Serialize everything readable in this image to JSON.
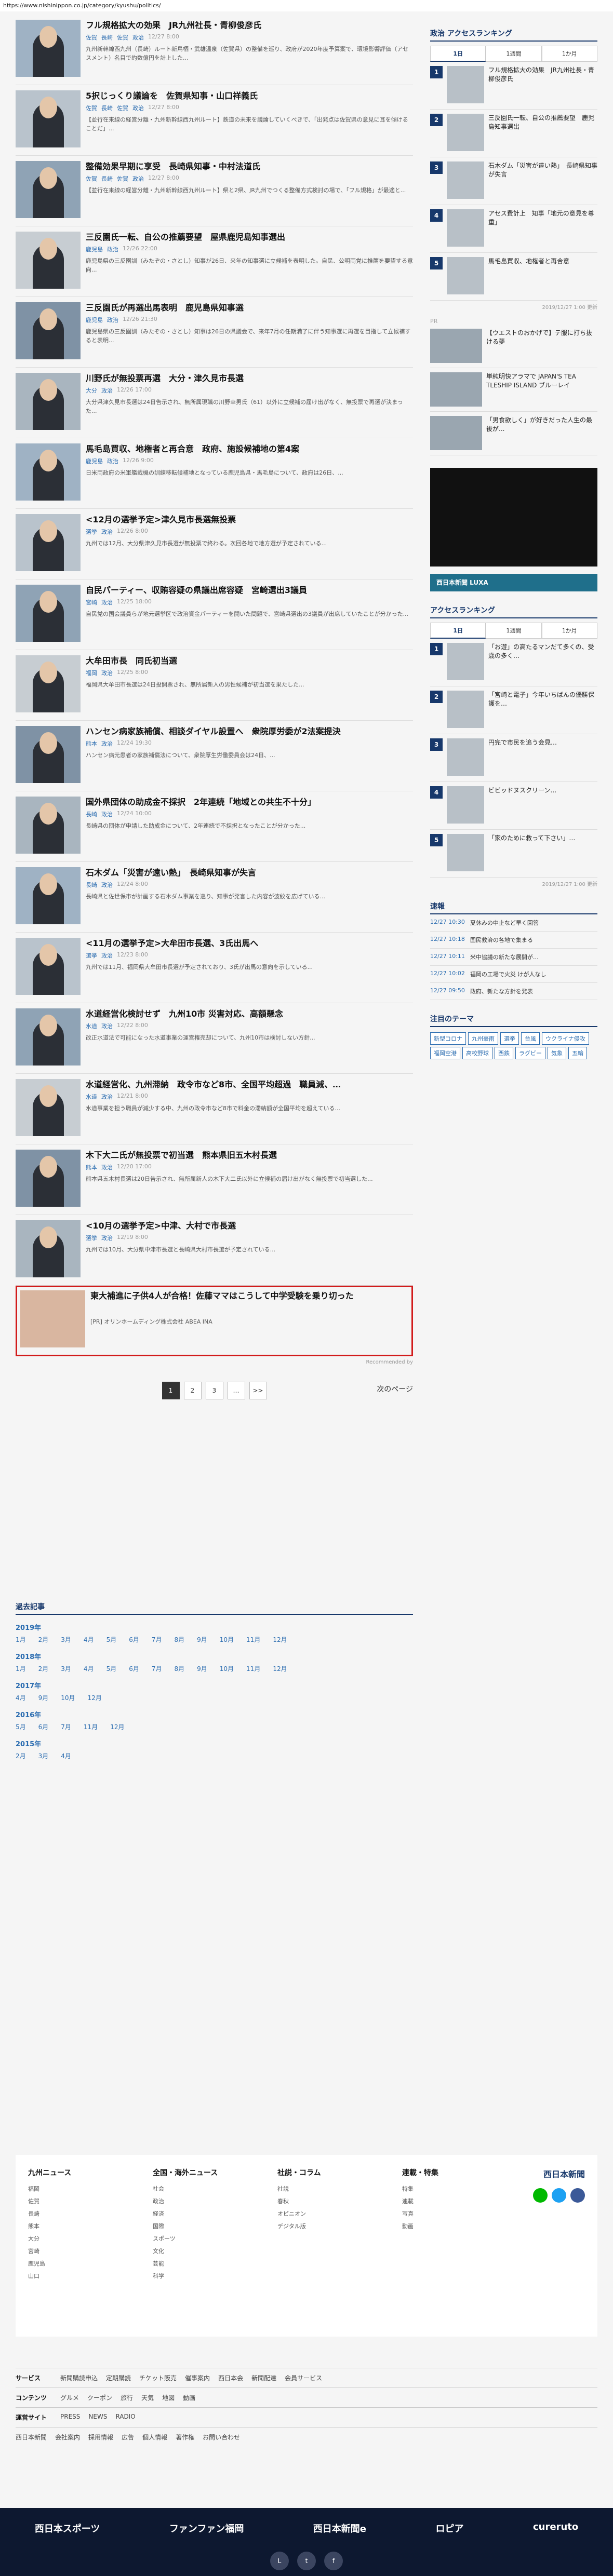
{
  "url": "https://www.nishinippon.co.jp/category/kyushu/politics/",
  "articles": [
    {
      "title": "フル規格拡大の効果　JR九州社長・青柳俊彦氏",
      "tags": [
        "佐賀",
        "長崎",
        "佐賀",
        "政治"
      ],
      "date": "12/27 8:00",
      "lead": "九州新幹線西九州（長崎）ルート新鳥栖・武雄温泉（佐賀県）の整備を巡り、政府が2020年度予算案で、環境影響評価（アセスメント）名目で約数億円を計上した..."
    },
    {
      "title": "5択じっくり議論を　佐賀県知事・山口祥義氏",
      "tags": [
        "佐賀",
        "長崎",
        "佐賀",
        "政治"
      ],
      "date": "12/27 8:00",
      "lead": "【並行在来線の経営分離・九州新幹線西九州ルート】鉄道の未来を議論していくべきで、「出発点は佐賀県の意見に耳を傾けることだ」..."
    },
    {
      "title": "整備効果早期に享受　長崎県知事・中村法道氏",
      "tags": [
        "佐賀",
        "長崎",
        "佐賀",
        "政治"
      ],
      "date": "12/27 8:00",
      "lead": "【並行在来線の経営分離・九州新幹線西九州ルート】県と2県、JR九州でつくる整備方式検討の場で、「フル規格」が最適と..."
    },
    {
      "title": "三反園氏一転、自公の推薦要望　屋県鹿児島知事選出",
      "tags": [
        "鹿児島",
        "政治"
      ],
      "date": "12/26 22:00",
      "lead": "鹿児島県の三反園訓（みたぞの・さとし）知事が26日、来年の知事選に立候補を表明した。自民、公明両党に推薦を要望する意向..."
    },
    {
      "title": "三反園氏が再選出馬表明　鹿児島県知事選",
      "tags": [
        "鹿児島",
        "政治"
      ],
      "date": "12/26 21:30",
      "lead": "鹿児島県の三反園訓（みたぞの・さとし）知事は26日の県議会で、来年7月の任期満了に伴う知事選に再選を目指して立候補すると表明..."
    },
    {
      "title": "川野氏が無投票再選　大分・津久見市長選",
      "tags": [
        "大分",
        "政治"
      ],
      "date": "12/26 17:00",
      "lead": "大分県津久見市長選は24日告示され、無所属現職の川野幸男氏（61）以外に立候補の届け出がなく、無投票で再選が決まった..."
    },
    {
      "title": "馬毛島買収、地権者と再合意　政府、施設候補地の第4案",
      "tags": [
        "鹿児島",
        "政治"
      ],
      "date": "12/26 9:00",
      "lead": "日米両政府の米軍艦載機の訓練移転候補地となっている鹿児島県・馬毛島について、政府は26日、..."
    },
    {
      "title": "<12月の選挙予定>津久見市長選無投票",
      "tags": [
        "選挙",
        "政治"
      ],
      "date": "12/26 8:00",
      "lead": "九州では12月、大分県津久見市長選が無投票で終わる。次回各地で地方選が予定されている..."
    },
    {
      "title": "自民パーティー、収賄容疑の県議出席容疑　宮崎選出3議員",
      "tags": [
        "宮崎",
        "政治"
      ],
      "date": "12/25 18:00",
      "lead": "自民党の国会議員らが地元選挙区で政治資金パーティーを開いた問題で、宮崎県選出の3議員が出席していたことが分かった..."
    },
    {
      "title": "大牟田市長　同氏初当選",
      "tags": [
        "福岡",
        "政治"
      ],
      "date": "12/25 8:00",
      "lead": "福岡県大牟田市長選は24日投開票され、無所属新人の男性候補が初当選を果たした..."
    },
    {
      "title": "ハンセン病家族補償、相談ダイヤル設置へ　衆院厚労委が2法案提決",
      "tags": [
        "熊本",
        "政治"
      ],
      "date": "12/24 19:30",
      "lead": "ハンセン病元患者の家族補償法について、衆院厚生労働委員会は24日、..."
    },
    {
      "title": "国外県団体の助成金不採択　2年連続「地域との共生不十分」",
      "tags": [
        "長崎",
        "政治"
      ],
      "date": "12/24 10:00",
      "lead": "長崎県の団体が申請した助成金について、2年連続で不採択となったことが分かった..."
    },
    {
      "title": "石木ダム「災害が遠い熱」　長崎県知事が失言",
      "tags": [
        "長崎",
        "政治"
      ],
      "date": "12/24 8:00",
      "lead": "長崎県と佐世保市が計画する石木ダム事業を巡り、知事が発言した内容が波紋を広げている..."
    },
    {
      "title": "<11月の選挙予定>大牟田市長選、3氏出馬へ",
      "tags": [
        "選挙",
        "政治"
      ],
      "date": "12/23 8:00",
      "lead": "九州では11月、福岡県大牟田市長選が予定されており、3氏が出馬の意向を示している..."
    },
    {
      "title": "水道経営化検討せず　九州10市 災害対応、高額懸念",
      "tags": [
        "水道",
        "政治"
      ],
      "date": "12/22 8:00",
      "lead": "改正水道法で可能になった水道事業の運営権売却について、九州10市は検討しない方針..."
    },
    {
      "title": "水道経営化、九州滞納　政令市など8市、全国平均超過　職員減、…",
      "tags": [
        "水道",
        "政治"
      ],
      "date": "12/21 8:00",
      "lead": "水道事業を担う職員が減少する中、九州の政令市など8市で料金の滞納額が全国平均を超えている..."
    },
    {
      "title": "木下大二氏が無投票で初当選　熊本県旧五木村長選",
      "tags": [
        "熊本",
        "政治"
      ],
      "date": "12/20 17:00",
      "lead": "熊本県五木村長選は20日告示され、無所属新人の木下大二氏以外に立候補の届け出がなく無投票で初当選した..."
    },
    {
      "title": "<10月の選挙予定>中津、大村で市長選",
      "tags": [
        "選挙",
        "政治"
      ],
      "date": "12/19 8:00",
      "lead": "九州では10月、大分県中津市長選と長崎県大村市長選が予定されている..."
    }
  ],
  "ad": {
    "title": "東大補進に子供4人が合格！佐藤ママはこうして中学受験を乗り切った",
    "sponsor": "[PR] オリンホームディング株式会社 ABEA INA"
  },
  "recommended": "Recommended by",
  "pager": {
    "pages": [
      "1",
      "2",
      "3",
      "…",
      ">>"
    ],
    "next": "次のページ"
  },
  "side": {
    "ranking1_title": "政治 アクセスランキング",
    "tabs1": [
      "1日",
      "1週間",
      "1か月"
    ],
    "ranking1": [
      "フル規格拡大の効果　JR九州社長・青柳俊彦氏",
      "三反園氏一転、自公の推薦要望　鹿児島知事選出",
      "石木ダム「災害が遠い熱」　長崎県知事が失言",
      "アセス費計上　知事「地元の意見を尊重」",
      "馬毛島買収、地権者と再合意"
    ],
    "ranking1_date": "2019/12/27 1:00 更新",
    "pr_label": "PR",
    "promos": [
      "【ウエストのおかげで】テ服に打ち抜ける夢",
      "単純明快アラマで JAPAN'S TEA TLESHIP ISLAND ブルーレイ",
      "「男食欲しく」が好きだった人生の最後が..."
    ],
    "banner_label": "西日本新聞 LUXA",
    "ranking2_title": "アクセスランキング",
    "tabs2": [
      "1日",
      "1週間",
      "1か月"
    ],
    "ranking2": [
      "「お遊」の高たるマンだて多くの、受歳の多く…",
      "「宮崎と電子」今年いちばんの優勝保護を…",
      "円完で市民を追う会見…",
      "ビビッドヌスクリーン…",
      "「家のために救って下さい」…"
    ],
    "ranking2_date": "2019/12/27 1:00 更新",
    "news_title": "速報",
    "news": [
      {
        "t": "12/27 10:30",
        "s": "夏休みの中止など早く回答"
      },
      {
        "t": "12/27 10:18",
        "s": "国民救済の各地で集まる"
      },
      {
        "t": "12/27 10:11",
        "s": "米中協議の新たな展開が…"
      },
      {
        "t": "12/27 10:02",
        "s": "福岡の工場で火災 けが人なし"
      },
      {
        "t": "12/27 09:50",
        "s": "政府、新たな方針を発表"
      }
    ],
    "theme_title": "注目のテーマ",
    "themes": [
      "新型コロナ",
      "九州豪雨",
      "選挙",
      "台風",
      "ウクライナ侵攻",
      "福岡空港",
      "高校野球",
      "西鉄",
      "ラグビー",
      "気象",
      "五輪"
    ]
  },
  "archive": {
    "title": "過去記事",
    "years": [
      {
        "y": "2019年",
        "m": [
          "1月",
          "2月",
          "3月",
          "4月",
          "5月",
          "6月",
          "7月",
          "8月",
          "9月",
          "10月",
          "11月",
          "12月"
        ]
      },
      {
        "y": "2018年",
        "m": [
          "1月",
          "2月",
          "3月",
          "4月",
          "5月",
          "6月",
          "7月",
          "8月",
          "9月",
          "10月",
          "11月",
          "12月"
        ]
      },
      {
        "y": "2017年",
        "m": [
          "4月",
          "9月",
          "10月",
          "12月"
        ]
      },
      {
        "y": "2016年",
        "m": [
          "5月",
          "6月",
          "7月",
          "11月",
          "12月"
        ]
      },
      {
        "y": "2015年",
        "m": [
          "2月",
          "3月",
          "4月"
        ]
      }
    ]
  },
  "footer": {
    "cols": [
      {
        "h": "九州ニュース",
        "items": [
          "福岡",
          "佐賀",
          "長崎",
          "熊本",
          "大分",
          "宮崎",
          "鹿児島",
          "山口"
        ]
      },
      {
        "h": "全国・海外ニュース",
        "items": [
          "社会",
          "政治",
          "経済",
          "国際",
          "スポーツ",
          "文化",
          "芸能",
          "科学"
        ]
      },
      {
        "h": "社説・コラム",
        "items": [
          "社説",
          "春秋",
          "オピニオン",
          "デジタル版"
        ]
      },
      {
        "h": "連載・特集",
        "items": [
          "特集",
          "連載",
          "写真",
          "動画"
        ]
      }
    ],
    "brand": "西日本新聞"
  },
  "bottomnav": [
    {
      "k": "サービス",
      "v": [
        "新聞購読申込",
        "定期購読",
        "チケット販売",
        "催事案内",
        "西日本会",
        "新聞配達",
        "会員サービス"
      ]
    },
    {
      "k": "コンテンツ",
      "v": [
        "グルメ",
        "クーポン",
        "旅行",
        "天気",
        "地図",
        "動画"
      ]
    },
    {
      "k": "運営サイト",
      "v": [
        "PRESS",
        "NEWS",
        "RADIO"
      ]
    }
  ],
  "company": [
    "西日本新聞",
    "会社案内",
    "採用情報",
    "広告",
    "個人情報",
    "著作権",
    "お問い合わせ"
  ],
  "sites": [
    "西日本スポーツ",
    "ファンファン福岡",
    "西日本新聞e",
    "ロピア",
    "cureruto"
  ],
  "sns": [
    "LINE",
    "Twitter",
    "Facebook"
  ]
}
